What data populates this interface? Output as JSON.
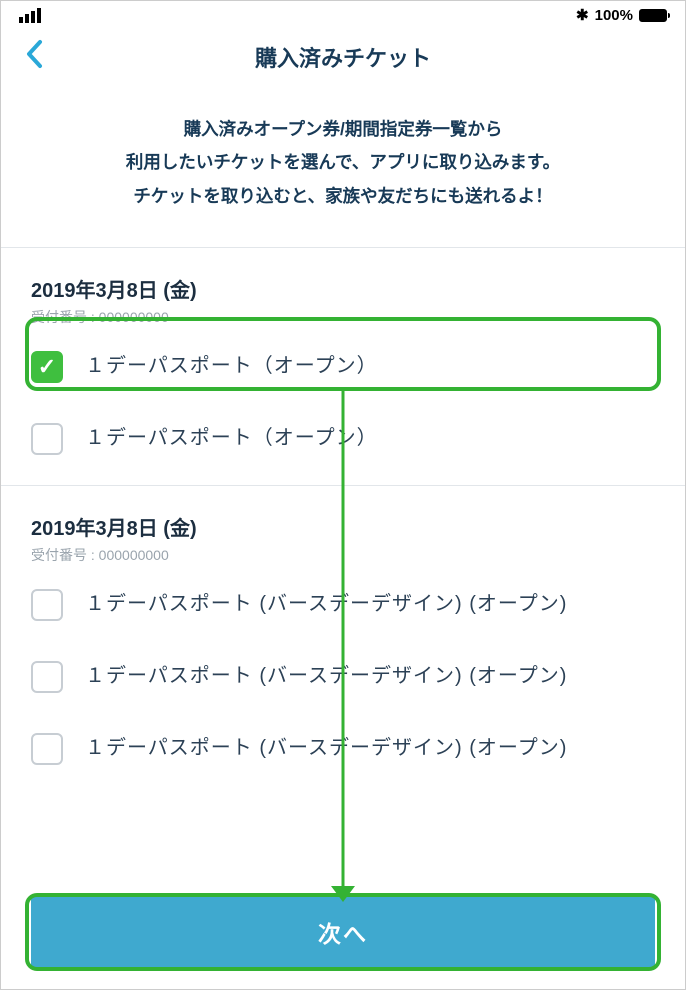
{
  "status": {
    "battery_pct": "100%"
  },
  "header": {
    "title": "購入済みチケット"
  },
  "intro": {
    "line1": "購入済みオープン券/期間指定券一覧から",
    "line2": "利用したいチケットを選んで、アプリに取り込みます。",
    "line3": "チケットを取り込むと、家族や友だちにも送れるよ！"
  },
  "groups": [
    {
      "date": "2019年3月8日 (金)",
      "ref_label": "受付番号 :",
      "ref_value": "000000000",
      "tickets": [
        {
          "label": "１デーパスポート（オープン）",
          "checked": true
        },
        {
          "label": "１デーパスポート（オープン）",
          "checked": false
        }
      ]
    },
    {
      "date": "2019年3月8日 (金)",
      "ref_label": "受付番号 :",
      "ref_value": "000000000",
      "tickets": [
        {
          "label": "１デーパスポート (バースデーデザイン) (オープン)",
          "checked": false
        },
        {
          "label": "１デーパスポート (バースデーデザイン) (オープン)",
          "checked": false
        },
        {
          "label": "１デーパスポート (バースデーデザイン) (オープン)",
          "checked": false
        }
      ]
    }
  ],
  "footer": {
    "next_label": "次へ"
  }
}
